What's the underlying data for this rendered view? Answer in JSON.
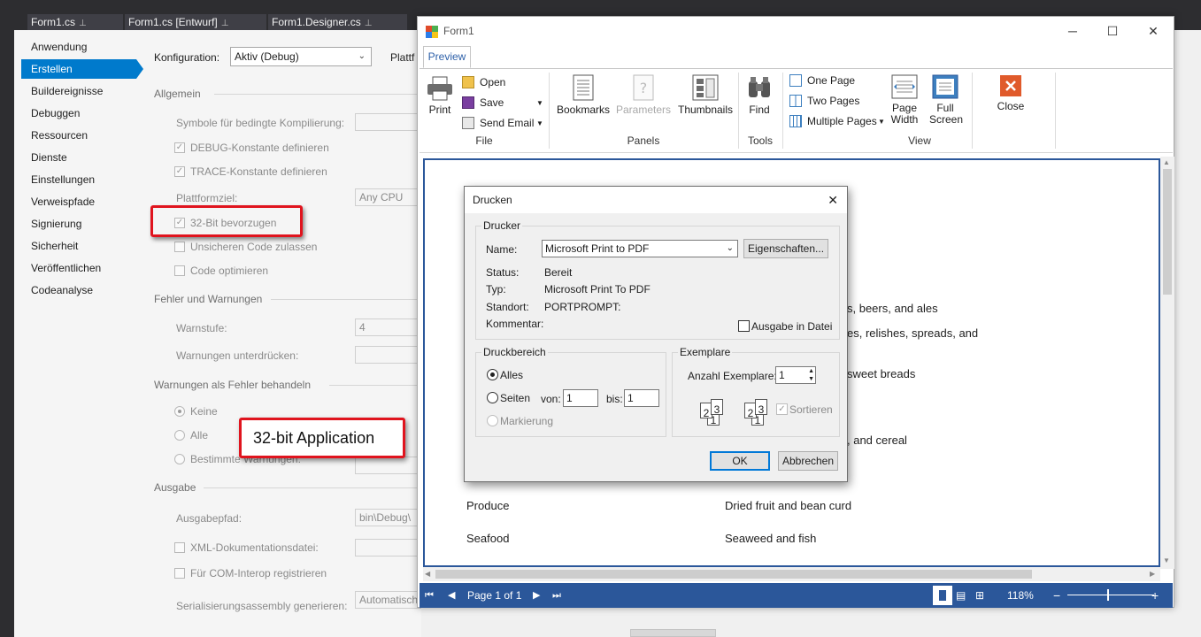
{
  "vs": {
    "tabs": [
      {
        "label": "Form1.cs"
      },
      {
        "label": "Form1.cs [Entwurf]"
      },
      {
        "label": "Form1.Designer.cs"
      }
    ]
  },
  "props": {
    "sidebar": [
      "Anwendung",
      "Erstellen",
      "Buildereignisse",
      "Debuggen",
      "Ressourcen",
      "Dienste",
      "Einstellungen",
      "Verweispfade",
      "Signierung",
      "Sicherheit",
      "Veröffentlichen",
      "Codeanalyse"
    ],
    "config_label": "Konfiguration:",
    "config_value": "Aktiv (Debug)",
    "platform_label": "Plattf",
    "sections": {
      "general": "Allgemein",
      "errors": "Fehler und Warnungen",
      "warn_as_errors": "Warnungen als Fehler behandeln",
      "output": "Ausgabe"
    },
    "symbols_label": "Symbole für bedingte Kompilierung:",
    "debug_const": "DEBUG-Konstante definieren",
    "trace_const": "TRACE-Konstante definieren",
    "platform_target_label": "Plattformziel:",
    "platform_target_value": "Any CPU",
    "prefer32": "32-Bit bevorzugen",
    "unsafe": "Unsicheren Code zulassen",
    "optimize": "Code optimieren",
    "warn_level_label": "Warnstufe:",
    "warn_level_value": "4",
    "suppress_label": "Warnungen unterdrücken:",
    "radio_none": "Keine",
    "radio_all": "Alle",
    "radio_specific": "Bestimmte Warnungen:",
    "output_path_label": "Ausgabepfad:",
    "output_path_value": "bin\\Debug\\",
    "xml_doc": "XML-Dokumentationsdatei:",
    "com_interop": "Für COM-Interop registrieren",
    "serialization_label": "Serialisierungsassembly generieren:",
    "serialization_value": "Automatisch"
  },
  "callout": {
    "text": "32-bit Application",
    "accent": "#e0141e"
  },
  "form1": {
    "title": "Form1",
    "ribbon_tab": "Preview",
    "buttons": {
      "print": "Print",
      "open": "Open",
      "save": "Save",
      "send_email": "Send Email",
      "bookmarks": "Bookmarks",
      "parameters": "Parameters",
      "thumbnails": "Thumbnails",
      "find": "Find",
      "one_page": "One Page",
      "two_pages": "Two Pages",
      "multiple_pages": "Multiple Pages",
      "page_width_1": "Page",
      "page_width_2": "Width",
      "full_screen_1": "Full",
      "full_screen_2": "Screen",
      "close": "Close"
    },
    "groups": {
      "file": "File",
      "panels": "Panels",
      "tools": "Tools",
      "view": "View"
    },
    "preview_rows": [
      {
        "text": "s, beers, and ales"
      },
      {
        "text": "es, relishes, spreads, and"
      },
      {
        "text": "sweet breads"
      },
      {
        "text": ", and cereal"
      },
      {
        "text": "Produce"
      },
      {
        "text": "Dried fruit and bean curd"
      },
      {
        "text": "Seafood"
      },
      {
        "text": "Seaweed and fish"
      }
    ],
    "status": {
      "page": "Page 1 of 1",
      "zoom": "118%"
    },
    "accent": "#2b579a"
  },
  "dialog": {
    "title": "Drucken",
    "printer_group": "Drucker",
    "name_label": "Name:",
    "printer_name": "Microsoft Print to PDF",
    "properties_button": "Eigenschaften...",
    "status_label": "Status:",
    "status_value": "Bereit",
    "type_label": "Typ:",
    "type_value": "Microsoft Print To PDF",
    "location_label": "Standort:",
    "location_value": "PORTPROMPT:",
    "comment_label": "Kommentar:",
    "print_to_file": "Ausgabe in Datei",
    "range_group": "Druckbereich",
    "range_all": "Alles",
    "range_pages": "Seiten",
    "from_label": "von:",
    "from_value": "1",
    "to_label": "bis:",
    "to_value": "1",
    "range_selection": "Markierung",
    "copies_group": "Exemplare",
    "copies_label": "Anzahl Exemplare:",
    "copies_value": "1",
    "collate": "Sortieren",
    "ok": "OK",
    "cancel": "Abbrechen"
  }
}
